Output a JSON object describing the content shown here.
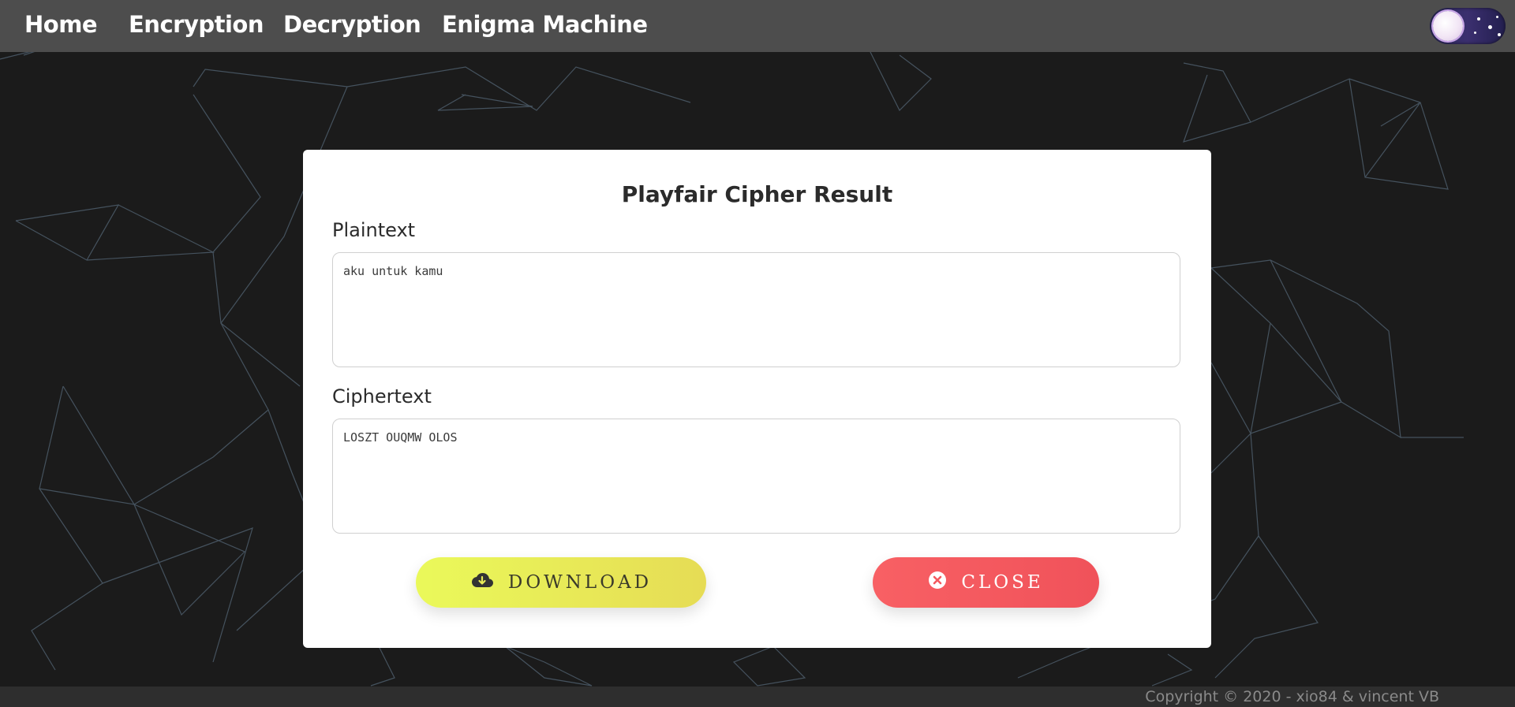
{
  "nav": {
    "items": [
      {
        "label": "Home"
      },
      {
        "label": "Encryption"
      },
      {
        "label": "Decryption"
      },
      {
        "label": "Enigma Machine"
      }
    ],
    "theme_toggle": {
      "icon": "moon-icon",
      "state": "dark"
    }
  },
  "modal": {
    "title": "Playfair Cipher Result",
    "plaintext_label": "Plaintext",
    "plaintext_value": "aku untuk kamu",
    "ciphertext_label": "Ciphertext",
    "ciphertext_value": "LOSZT OUQMW OLOS",
    "download_label": "DOWNLOAD",
    "close_label": "CLOSE"
  },
  "footer": {
    "copyright": "Copyright © 2020 - xio84 & vincent VB"
  },
  "colors": {
    "navbar": "#4d4d4d",
    "background": "#1b1b1b",
    "download_button": "#e8ec58",
    "close_button": "#f45a5f",
    "network_lines": "#4a5a66"
  }
}
